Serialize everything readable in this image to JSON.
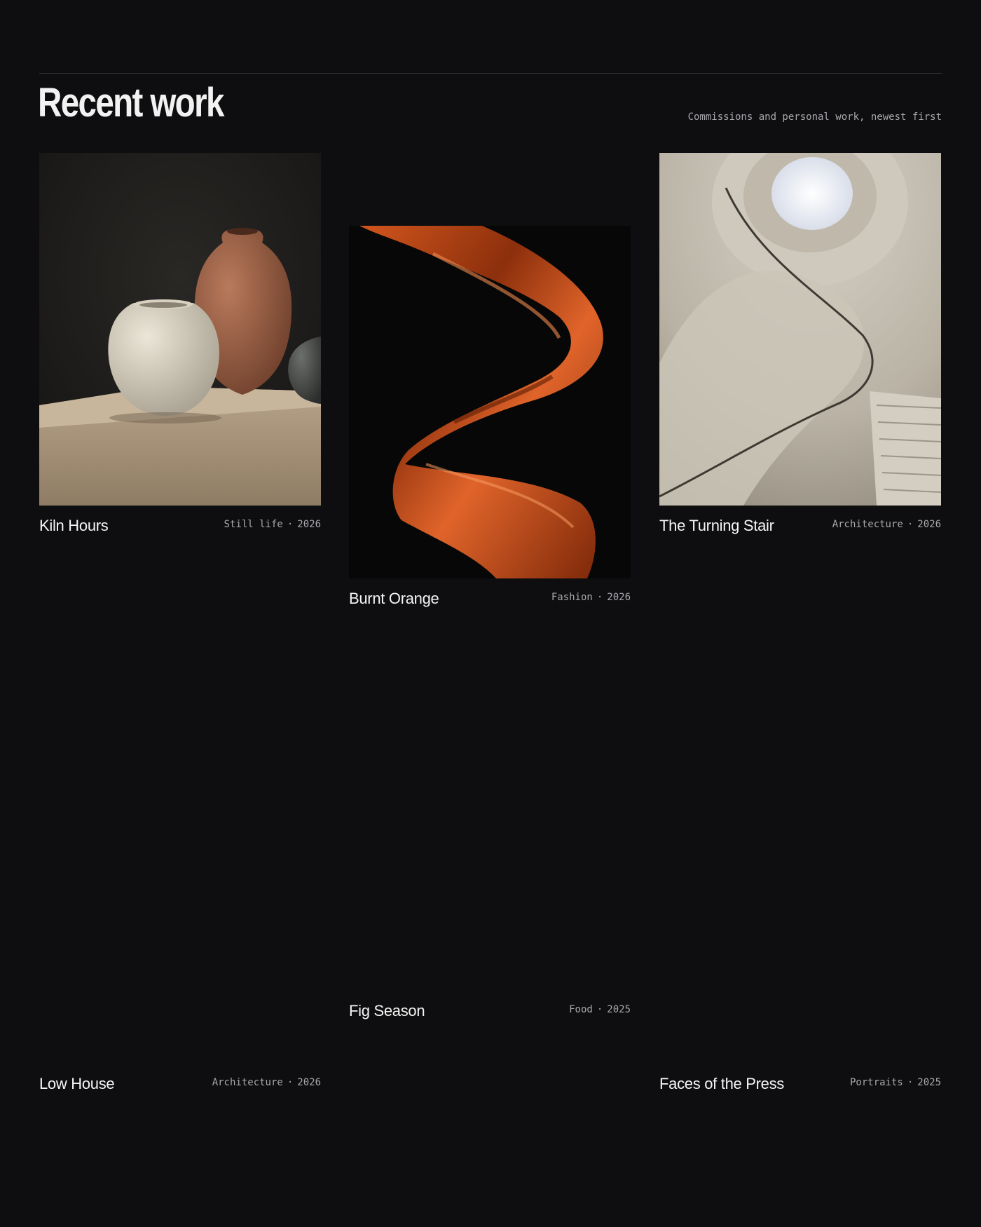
{
  "header": {
    "title": "Recent work",
    "subtitle": "Commissions and personal work, newest first"
  },
  "projects": [
    {
      "title": "Kiln Hours",
      "category": "Still life",
      "year": "2026",
      "image": "ceramic-vases-on-travertine"
    },
    {
      "title": "Burnt Orange",
      "category": "Fashion",
      "year": "2026",
      "image": "orange-silk-fabric-on-black"
    },
    {
      "title": "The Turning Stair",
      "category": "Architecture",
      "year": "2026",
      "image": "spiral-concrete-staircase-skylight"
    },
    {
      "title": "Fig Season",
      "category": "Food",
      "year": "2025",
      "image": ""
    },
    {
      "title": "Low House",
      "category": "Architecture",
      "year": "2026",
      "image": ""
    },
    {
      "title": "Faces of the Press",
      "category": "Portraits",
      "year": "2025",
      "image": ""
    }
  ],
  "separator": "·"
}
